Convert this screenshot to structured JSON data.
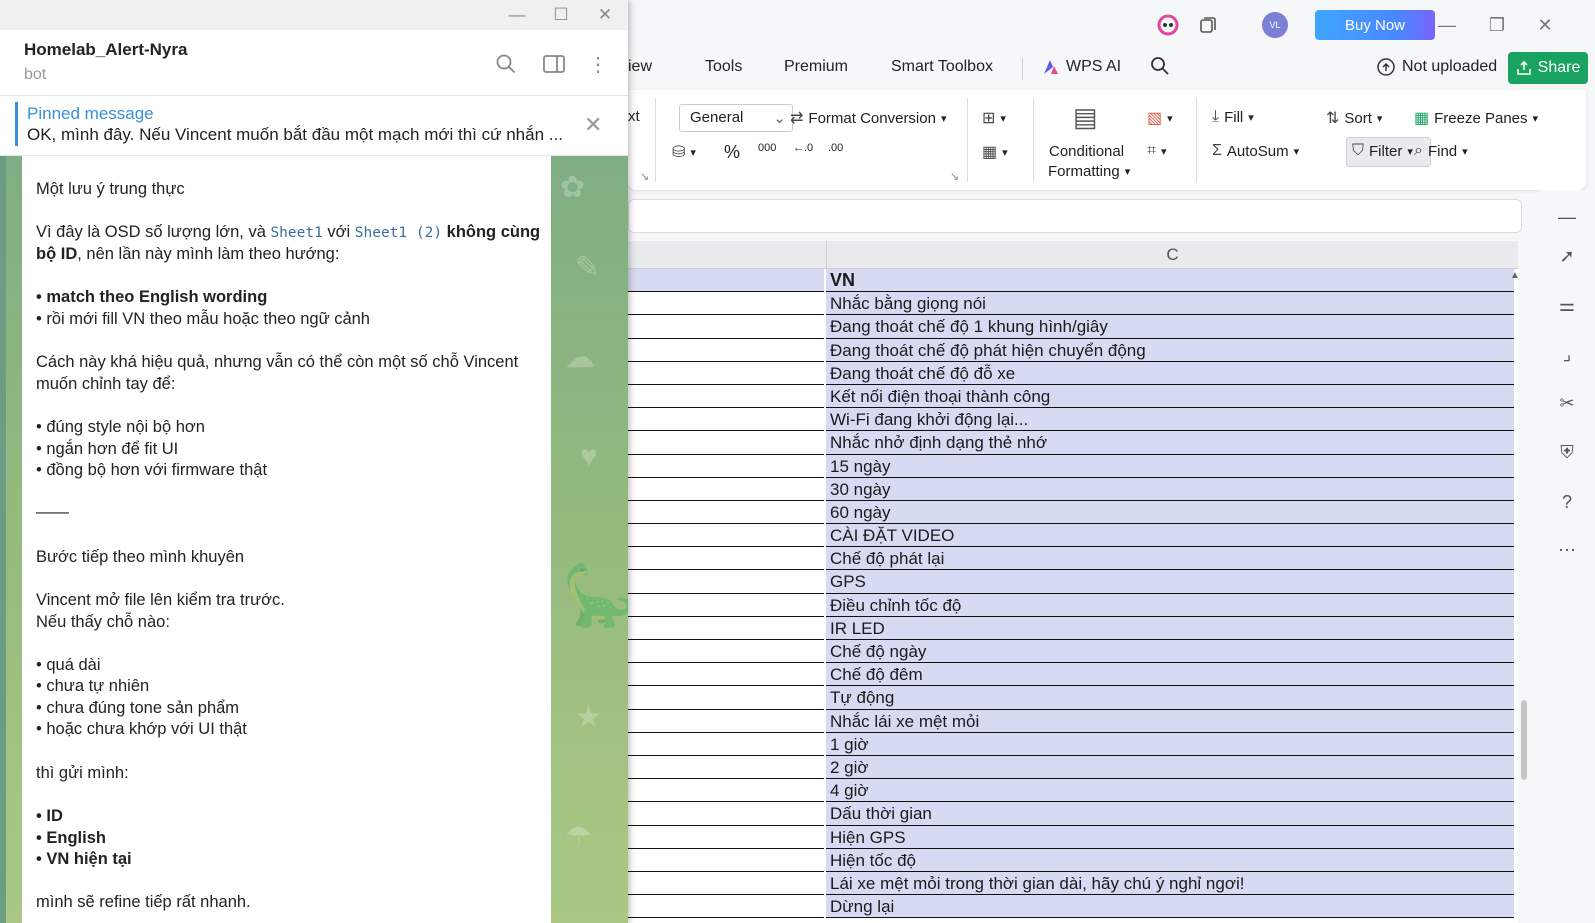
{
  "wps": {
    "buy_now": "Buy Now",
    "avatar": "VL",
    "menu": [
      "iew",
      "Tools",
      "Premium",
      "Smart Toolbox",
      "WPS AI"
    ],
    "not_uploaded": "Not uploaded",
    "share": "Share",
    "ribbon": {
      "xt": "xt",
      "general": "General",
      "format_conversion": "Format Conversion",
      "percent": "%",
      "thousands": "000",
      "dec_inc": "←.0",
      "dec_dec": ".00",
      "conditional": "Conditional",
      "formatting": "Formatting",
      "fill": "Fill",
      "sort": "Sort",
      "freeze_panes": "Freeze Panes",
      "autosum": "AutoSum",
      "filter": "Filter",
      "find": "Find"
    },
    "column_c": "C",
    "header_cell": "VN",
    "rows": [
      "Nhắc bằng giọng nói",
      "Đang thoát chế độ 1 khung hình/giây",
      "Đang thoát chế độ phát hiện chuyển động",
      "Đang thoát chế độ đỗ xe",
      "Kết nối điện thoại thành công",
      " Wi-Fi đang khởi động lại...",
      "Nhắc nhở định dạng thẻ nhớ",
      "15 ngày",
      "30 ngày",
      "60 ngày",
      "CÀI ĐẶT VIDEO",
      "Chế độ phát lại",
      "GPS",
      "Điều chỉnh tốc độ",
      "IR LED",
      "Chế độ ngày",
      "Chế độ đêm",
      "Tự động",
      "Nhắc lái xe mệt mỏi",
      "1 giờ",
      "2 giờ",
      "4 giờ",
      "Dấu thời gian",
      "Hiện GPS",
      "Hiện tốc độ",
      "Lái xe mệt mỏi trong thời gian dài, hãy chú ý nghỉ ngơi!",
      "Dừng lại"
    ]
  },
  "telegram": {
    "chat_name": "Homelab_Alert-Nyra",
    "chat_sub": "bot",
    "pinned_label": "Pinned message",
    "pinned_text": "OK, mình đây. Nếu Vincent muốn bắt đầu một mạch mới thì cứ nhắn ...",
    "m1": "Một lưu ý trung thực",
    "m2a": "Vì đây là OSD số lượng lớn, và ",
    "m2code1": "Sheet1",
    "m2b": " với ",
    "m2code2": "Sheet1 (2)",
    "m2c": " không cùng",
    "m2d": "bộ ID",
    "m2e": ", nên lần này mình làm theo hướng:",
    "m3": "• match theo English wording",
    "m4": "• rồi mới fill VN theo mẫu hoặc theo ngữ cảnh",
    "m5": "Cách này khá hiệu quả, nhưng vẫn có thể còn một số chỗ Vincent",
    "m6": "muốn chỉnh tay để:",
    "m7": "• đúng style nội bộ hơn",
    "m8": "• ngắn hơn để fit UI",
    "m9": "• đồng bộ hơn với firmware thật",
    "m10": "——",
    "m11": "Bước tiếp theo mình khuyên",
    "m12": "Vincent mở file lên kiểm tra trước.",
    "m13": "Nếu thấy chỗ nào:",
    "m14": "• quá dài",
    "m15": "• chưa tự nhiên",
    "m16": "• chưa đúng tone sản phẩm",
    "m17": "• hoặc chưa khớp với UI thật",
    "m18": "thì gửi mình:",
    "m19": "• ID",
    "m20": "• English",
    "m21": "• VN hiện tại",
    "m22": "mình sẽ refine tiếp rất nhanh."
  }
}
